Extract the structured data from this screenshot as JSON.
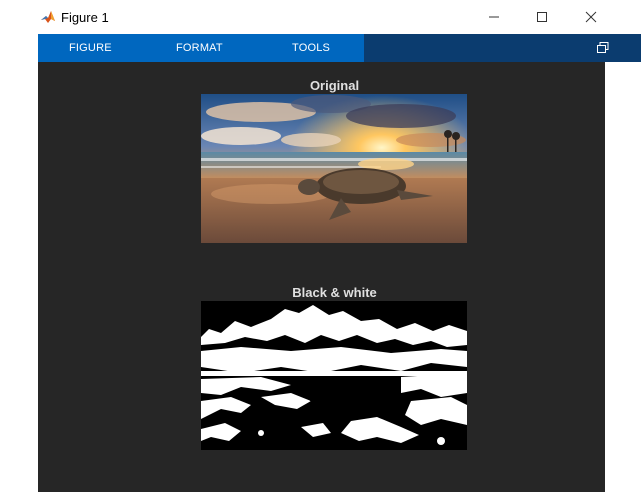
{
  "window": {
    "title": "Figure 1",
    "app_icon": "matlab-logo-icon",
    "controls": {
      "minimize_icon": "minimize-icon",
      "maximize_icon": "maximize-icon",
      "close_icon": "close-icon"
    }
  },
  "toolstrip": {
    "tabs": [
      {
        "label": "FIGURE"
      },
      {
        "label": "FORMAT"
      },
      {
        "label": "TOOLS"
      }
    ],
    "undock_icon": "undock-icon"
  },
  "figure": {
    "background": "#262626",
    "axes": [
      {
        "title": "Original",
        "image": "sea turtle on beach at sunset (color photo)"
      },
      {
        "title": "Black & white",
        "image": "binarized black and white version of the photo"
      }
    ]
  },
  "colors": {
    "toolstrip_active": "#0067bf",
    "toolstrip_bg": "#0b3c6f",
    "canvas": "#262626",
    "title_text": "#e0e0e0"
  }
}
